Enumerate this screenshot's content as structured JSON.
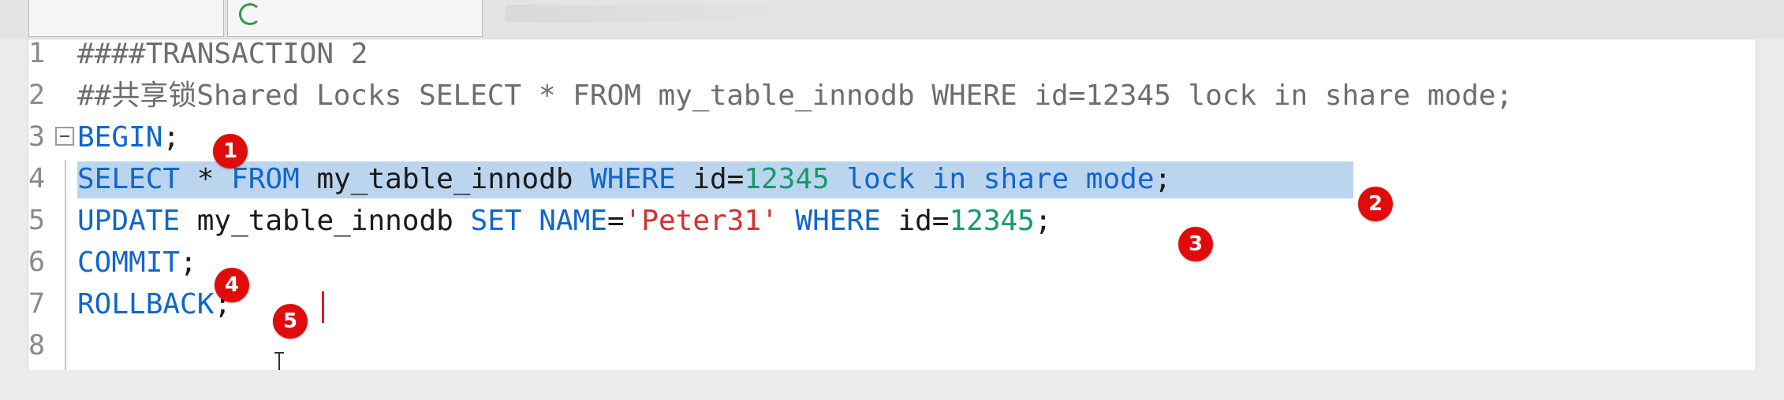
{
  "editor": {
    "lines": [
      {
        "num": "1",
        "parts": [
          {
            "t": "####TRANSACTION 2",
            "c": "cm"
          }
        ]
      },
      {
        "num": "2",
        "parts": [
          {
            "t": "##共享锁Shared Locks SELECT * FROM my_table_innodb WHERE id=12345 lock in share mode;",
            "c": "cm"
          }
        ]
      },
      {
        "num": "3",
        "fold": true,
        "parts": [
          {
            "t": "BEGIN",
            "c": "kw"
          },
          {
            "t": ";",
            "c": "pl"
          }
        ]
      },
      {
        "num": "4",
        "selected": true,
        "parts": [
          {
            "t": "SELECT",
            "c": "kw"
          },
          {
            "t": " * ",
            "c": "pl"
          },
          {
            "t": "FROM",
            "c": "kw"
          },
          {
            "t": " my_table_innodb ",
            "c": "pl"
          },
          {
            "t": "WHERE",
            "c": "kw"
          },
          {
            "t": " id=",
            "c": "pl"
          },
          {
            "t": "12345",
            "c": "num"
          },
          {
            "t": " lock in share mode",
            "c": "kw"
          },
          {
            "t": ";",
            "c": "pl"
          }
        ]
      },
      {
        "num": "5",
        "parts": [
          {
            "t": "UPDATE",
            "c": "kw"
          },
          {
            "t": " my_table_innodb ",
            "c": "pl"
          },
          {
            "t": "SET",
            "c": "kw"
          },
          {
            "t": " ",
            "c": "pl"
          },
          {
            "t": "NAME",
            "c": "kw"
          },
          {
            "t": "=",
            "c": "pl"
          },
          {
            "t": "'Peter31'",
            "c": "str"
          },
          {
            "t": " ",
            "c": "pl"
          },
          {
            "t": "WHERE",
            "c": "kw"
          },
          {
            "t": " id=",
            "c": "pl"
          },
          {
            "t": "12345",
            "c": "num"
          },
          {
            "t": ";",
            "c": "pl"
          }
        ]
      },
      {
        "num": "6",
        "parts": [
          {
            "t": "COMMIT",
            "c": "kw"
          },
          {
            "t": ";",
            "c": "pl"
          }
        ]
      },
      {
        "num": "7",
        "parts": [
          {
            "t": "ROLLBACK",
            "c": "kw"
          },
          {
            "t": ";",
            "c": "pl"
          }
        ]
      },
      {
        "num": "8",
        "parts": []
      }
    ]
  },
  "annotations": [
    {
      "label": "1"
    },
    {
      "label": "2"
    },
    {
      "label": "3"
    },
    {
      "label": "4"
    },
    {
      "label": "5"
    }
  ],
  "colors": {
    "keyword": "#1166cc",
    "comment": "#6e6e6e",
    "number": "#149a6a",
    "string": "#d23030",
    "selection": "#bcd5ee",
    "badge": "#e00b0b"
  }
}
